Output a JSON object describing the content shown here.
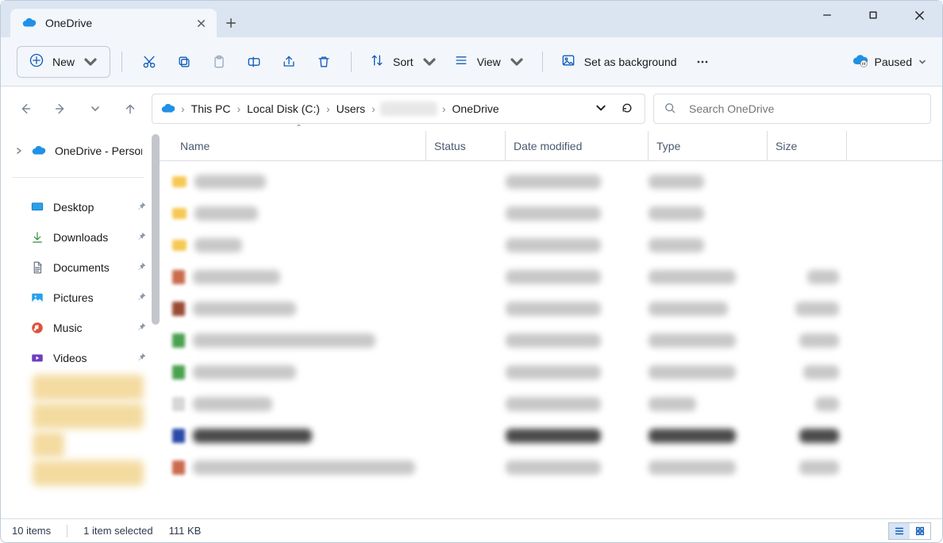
{
  "window": {
    "tab_title": "OneDrive"
  },
  "toolbar": {
    "new_label": "New",
    "sort_label": "Sort",
    "view_label": "View",
    "bg_label": "Set as background",
    "sync_status": "Paused"
  },
  "breadcrumbs": {
    "this_pc": "This PC",
    "local_disk": "Local Disk (C:)",
    "users": "Users",
    "onedrive": "OneDrive"
  },
  "search": {
    "placeholder": "Search OneDrive"
  },
  "columns": {
    "name": "Name",
    "status": "Status",
    "date": "Date modified",
    "type": "Type",
    "size": "Size"
  },
  "sidebar": {
    "onedrive_label": "OneDrive - Personal",
    "quick": {
      "desktop": "Desktop",
      "downloads": "Downloads",
      "documents": "Documents",
      "pictures": "Pictures",
      "music": "Music",
      "videos": "Videos"
    }
  },
  "statusbar": {
    "count": "10 items",
    "selection": "1 item selected",
    "size": "111 KB"
  }
}
